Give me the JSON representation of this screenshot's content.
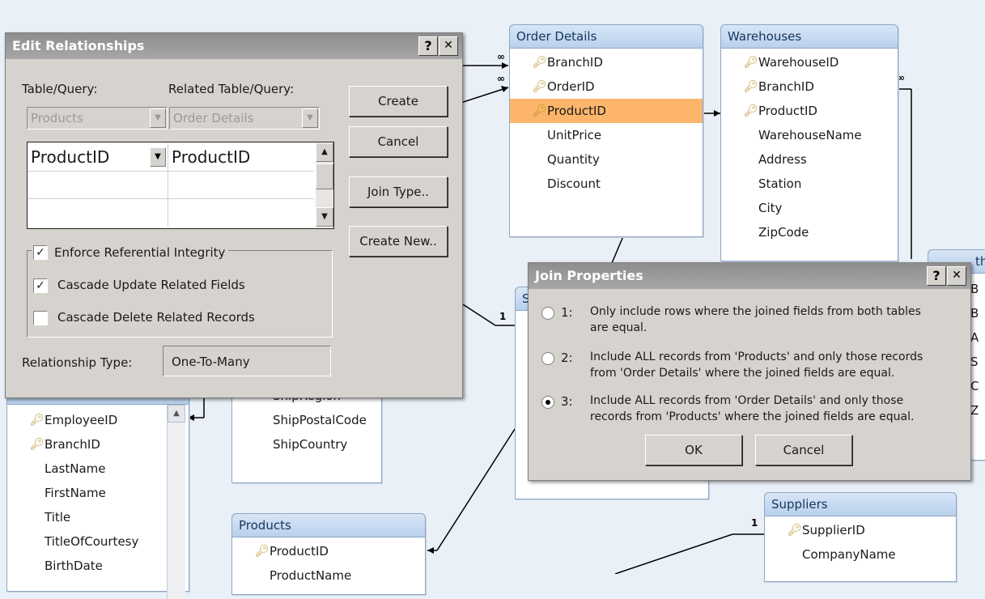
{
  "tables": {
    "order_details": {
      "title": "Order Details",
      "fields": [
        "BranchID",
        "OrderID",
        "ProductID",
        "UnitPrice",
        "Quantity",
        "Discount"
      ],
      "selected": "ProductID"
    },
    "warehouses": {
      "title": "Warehouses",
      "fields": [
        "WarehouseID",
        "BranchID",
        "ProductID",
        "WarehouseName",
        "Address",
        "Station",
        "City",
        "ZipCode"
      ]
    },
    "partial_right": {
      "title_fragment": "th",
      "fields": [
        "B",
        "B",
        "A",
        "S",
        "C",
        "Z"
      ]
    },
    "partial_mid": {
      "title_fragment": "S"
    },
    "employees": {
      "fields": [
        "EmployeeID",
        "BranchID",
        "LastName",
        "FirstName",
        "Title",
        "TitleOfCourtesy",
        "BirthDate"
      ]
    },
    "orders": {
      "fields": [
        "ShipRegion",
        "ShipPostalCode",
        "ShipCountry"
      ]
    },
    "products": {
      "title": "Products",
      "fields": [
        "ProductID",
        "ProductName"
      ]
    },
    "suppliers": {
      "title": "Suppliers",
      "fields": [
        "SupplierID",
        "CompanyName"
      ]
    }
  },
  "edit_relationships": {
    "title": "Edit Relationships",
    "help": "?",
    "close": "✕",
    "table_query_label": "Table/Query:",
    "related_table_query_label": "Related Table/Query:",
    "table_query_value": "Products",
    "related_table_query_value": "Order Details",
    "grid_rows": [
      [
        "ProductID",
        "ProductID"
      ],
      [
        "",
        ""
      ],
      [
        "",
        ""
      ]
    ],
    "buttons": {
      "create": "Create",
      "cancel": "Cancel",
      "join_type": "Join Type..",
      "create_new": "Create New.."
    },
    "enforce_integrity": {
      "label": "Enforce Referential Integrity",
      "checked": true
    },
    "cascade_update": {
      "label": "Cascade Update Related Fields",
      "checked": true
    },
    "cascade_delete": {
      "label": "Cascade Delete Related Records",
      "checked": false
    },
    "relationship_type_label": "Relationship Type:",
    "relationship_type_value": "One-To-Many"
  },
  "join_properties": {
    "title": "Join Properties",
    "help": "?",
    "close": "✕",
    "options": [
      {
        "num": "1:",
        "line1": "Only include rows where the joined fields from both tables",
        "line2": "are equal.",
        "selected": false
      },
      {
        "num": "2:",
        "line1": "Include ALL records from 'Products' and only those records",
        "line2": "from 'Order Details' where the joined fields are equal.",
        "selected": false
      },
      {
        "num": "3:",
        "line1": "Include ALL records from 'Order Details' and only those",
        "line2": "records from 'Products' where the joined fields are equal.",
        "selected": true
      }
    ],
    "ok": "OK",
    "cancel": "Cancel"
  },
  "relationship_labels": {
    "one": "1",
    "many": "∞"
  },
  "colors": {
    "canvas": "#eaf0f7",
    "table_header": "#c7dbf1",
    "selected_field": "#fcb56a",
    "dialog_face": "#d6d3ce",
    "dialog_title": "#9a9a9a"
  }
}
